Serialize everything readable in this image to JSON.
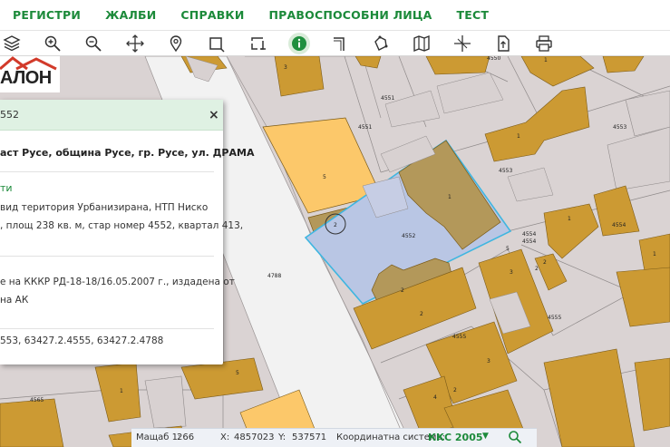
{
  "menu": {
    "items": [
      "РЕГИСТРИ",
      "ЖАЛБИ",
      "СПРАВКИ",
      "ПРАВОСПОСОБНИ ЛИЦА",
      "ТЕСТ"
    ]
  },
  "toolbar": {
    "tools": [
      "layers-icon",
      "zoom-in-icon",
      "zoom-out-icon",
      "pan-icon",
      "location-pin-icon",
      "select-rect-icon",
      "select-rect-alt-icon",
      "info-icon",
      "measure-angle-icon",
      "draw-polygon-icon",
      "map-icon",
      "crosshair-icon",
      "export-icon",
      "print-icon"
    ],
    "active_tool": "info-icon"
  },
  "logo": {
    "text": "АЛОН"
  },
  "info_panel": {
    "title": "552",
    "close": "×",
    "address": "аст Русе, община Русе, гр. Русе, ул. ДРАМА",
    "link": "ти",
    "desc_lines": [
      "вид   територия   Урбанизирана,   НТП   Ниско",
      ",  площ  238  кв.  м,  стар  номер  4552,  квартал  413,"
    ],
    "order_lines": [
      "е   на   КККР   РД-18-18/16.05.2007   г.,   издадена   от",
      "на АК"
    ],
    "neighbours": "553, 63427.2.4555, 63427.2.4788"
  },
  "map": {
    "street_label": "4788",
    "parcel_labels": [
      "3",
      "4550",
      "4551",
      "5",
      "2",
      "4552",
      "1",
      "4553",
      "4554",
      "5",
      "2",
      "2",
      "4555",
      "2",
      "4555",
      "4565",
      "3",
      "4",
      "2",
      "5",
      "1",
      "3",
      "2",
      "1",
      "1",
      "1",
      "1"
    ],
    "colors": {
      "road": "#f4f4f4",
      "parcel_fill": "#d9d2d2",
      "building": "#cc9a33",
      "building_yellow": "#fcc86a",
      "selected": "#b9c6e4",
      "selected_border": "#3fb6e0"
    }
  },
  "status_bar": {
    "scale_label": "Мащаб 1:",
    "scale_value": "266",
    "x_label": "X:",
    "x_value": "4857023",
    "y_label": "Y:",
    "y_value": "537571",
    "crs_label": "Координатна система:",
    "crs_value": "ККС 2005"
  }
}
